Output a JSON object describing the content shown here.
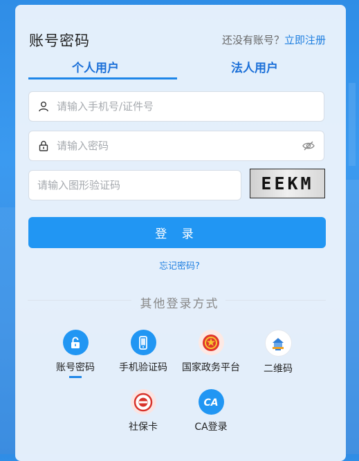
{
  "header": {
    "title": "账号密码",
    "register_prompt": "还没有账号？",
    "register_link": "立即注册"
  },
  "tabs": [
    {
      "label": "个人用户",
      "active": true
    },
    {
      "label": "法人用户",
      "active": false
    }
  ],
  "form": {
    "username_placeholder": "请输入手机号/证件号",
    "password_placeholder": "请输入密码",
    "captcha_placeholder": "请输入图形验证码",
    "captcha_text": "EEKM",
    "login_label": "登 录",
    "forgot_label": "忘记密码?"
  },
  "other_login": {
    "title": "其他登录方式",
    "options": [
      {
        "label": "账号密码",
        "icon": "lock-icon",
        "active": true
      },
      {
        "label": "手机验证码",
        "icon": "phone-icon",
        "active": false
      },
      {
        "label": "国家政务平台",
        "icon": "national-emblem-icon",
        "active": false
      },
      {
        "label": "二维码",
        "icon": "qrcode-app-icon",
        "active": false
      },
      {
        "label": "社保卡",
        "icon": "social-security-card-icon",
        "active": false
      },
      {
        "label": "CA登录",
        "icon": "ca-icon",
        "active": false
      }
    ]
  },
  "colors": {
    "accent": "#2196f3",
    "tab_text": "#1a6fd8",
    "link": "#1f7fe0"
  }
}
